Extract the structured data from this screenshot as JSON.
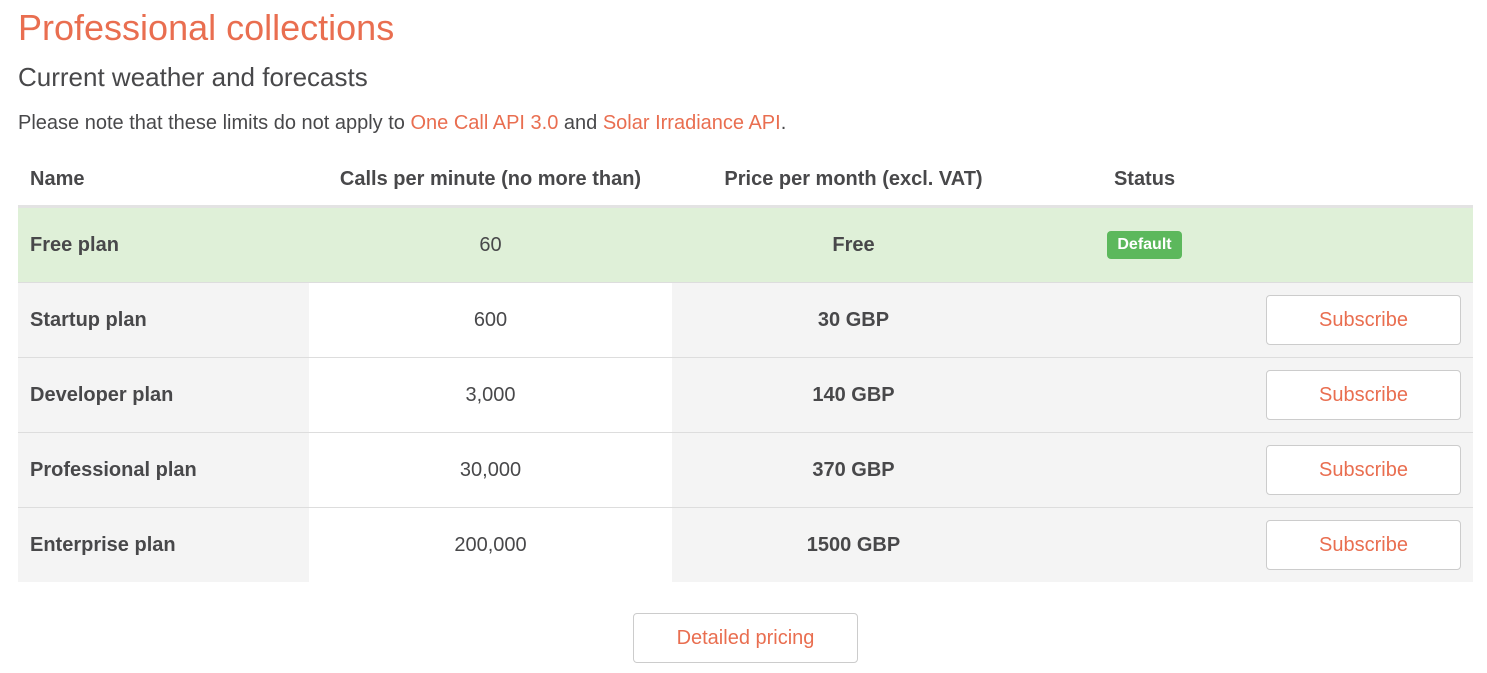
{
  "header": {
    "title": "Professional collections",
    "subtitle": "Current weather and forecasts"
  },
  "note": {
    "prefix": "Please note that these limits do not apply to ",
    "link1": "One Call API 3.0",
    "middle": " and ",
    "link2": "Solar Irradiance API",
    "suffix": "."
  },
  "table": {
    "headers": {
      "name": "Name",
      "calls": "Calls per minute (no more than)",
      "price": "Price per month (excl. VAT)",
      "status": "Status"
    },
    "free_plan": {
      "name": "Free plan",
      "calls": "60",
      "price": "Free",
      "status": "Default"
    },
    "paid_plans": [
      {
        "name": "Startup plan",
        "calls": "600",
        "price": "30 GBP",
        "action": "Subscribe"
      },
      {
        "name": "Developer plan",
        "calls": "3,000",
        "price": "140 GBP",
        "action": "Subscribe"
      },
      {
        "name": "Professional plan",
        "calls": "30,000",
        "price": "370 GBP",
        "action": "Subscribe"
      },
      {
        "name": "Enterprise plan",
        "calls": "200,000",
        "price": "1500 GBP",
        "action": "Subscribe"
      }
    ]
  },
  "footer": {
    "detailed_pricing_label": "Detailed pricing"
  },
  "colors": {
    "accent": "#e96e50",
    "text": "#48484a",
    "free_row_bg": "#dff0d8",
    "badge_green": "#5cb85c",
    "alt_row_bg": "#f4f4f4"
  }
}
